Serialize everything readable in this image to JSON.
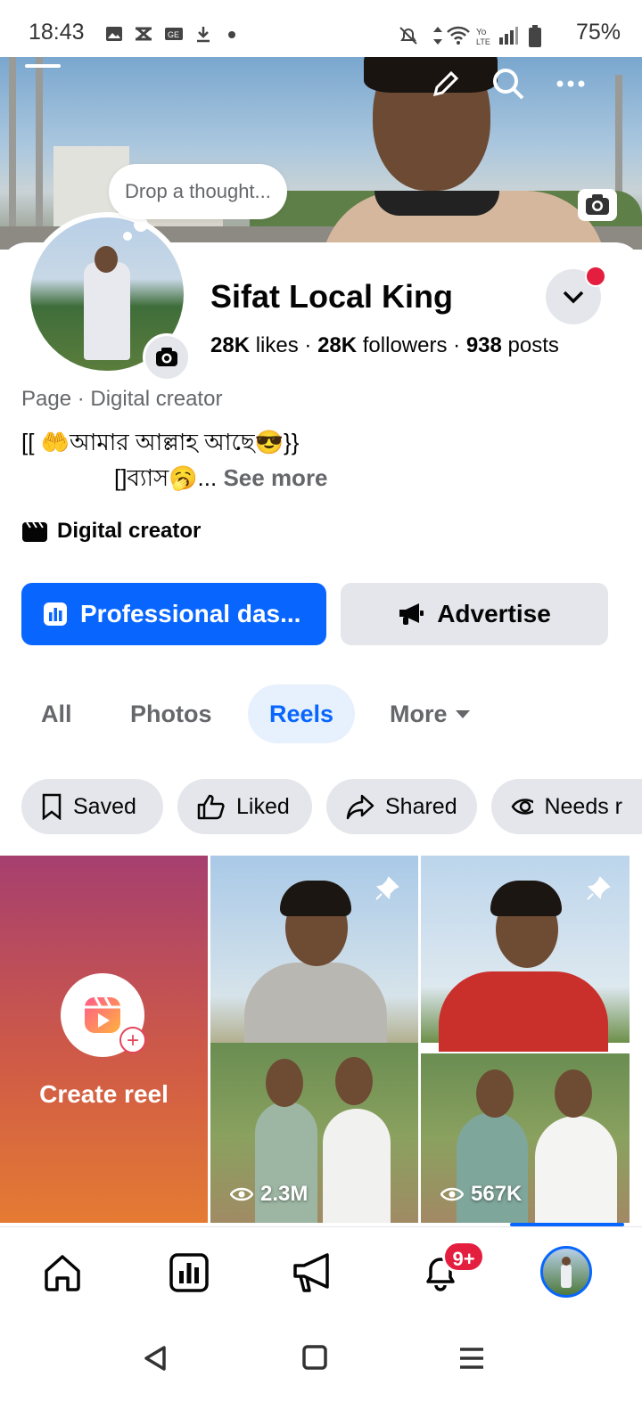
{
  "status_bar": {
    "time": "18:43",
    "battery": "75%",
    "icons": [
      "gallery-icon",
      "bluetooth-off-icon",
      "sim-card-icon",
      "download-icon",
      "dot-icon",
      "mute-icon",
      "data-arrows-icon",
      "wifi-icon",
      "volte-icon",
      "signal-icon",
      "battery-icon"
    ]
  },
  "cover": {
    "actions": [
      "edit-icon",
      "search-icon",
      "more-icon"
    ],
    "camera": "camera-icon"
  },
  "profile": {
    "thought_placeholder": "Drop a thought...",
    "name": "Sifat Local King",
    "likes_count": "28K",
    "likes_label": "likes",
    "followers_count": "28K",
    "followers_label": "followers",
    "posts_count": "938",
    "posts_label": "posts",
    "separator": "·",
    "category": "Page · Digital creator",
    "bio_line1": "[[ 🤲আমার আল্লাহ আছে😎}}",
    "bio_line2": "[]ব্যাস🥱...",
    "see_more": "See more",
    "creator_tag": "Digital creator"
  },
  "actions": {
    "primary": "Professional das...",
    "secondary": "Advertise"
  },
  "tabs": {
    "all": "All",
    "photos": "Photos",
    "reels": "Reels",
    "more": "More"
  },
  "chips": {
    "saved": "Saved",
    "liked": "Liked",
    "shared": "Shared",
    "needs": "Needs r"
  },
  "reels": {
    "create_label": "Create reel",
    "views1": "2.3M",
    "views2": "567K"
  },
  "bottom_nav": {
    "notifications_badge": "9+"
  },
  "colors": {
    "accent": "#0866ff",
    "badge": "#e41e3f",
    "chip_bg": "#e4e6eb",
    "tab_active_bg": "#e7f0fd"
  }
}
